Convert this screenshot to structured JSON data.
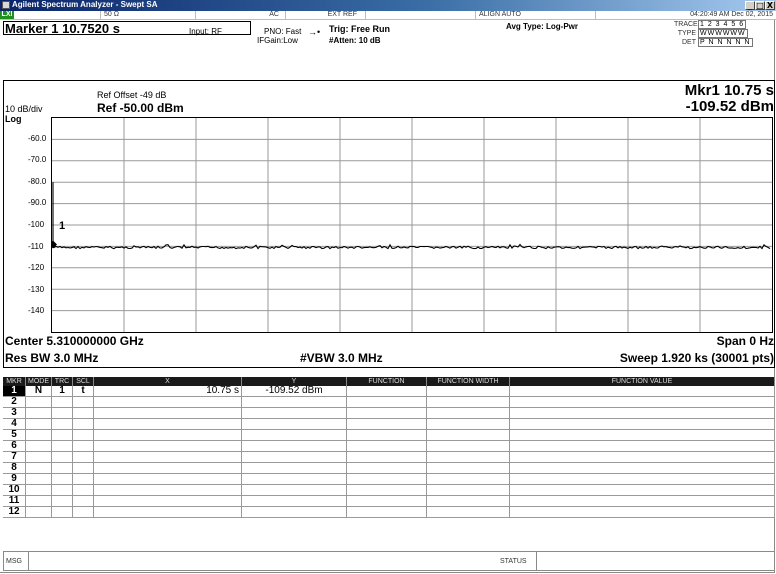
{
  "window": {
    "title": "Agilent Spectrum Analyzer - Swept SA",
    "minimize": "_",
    "maximize": "□",
    "close": "X"
  },
  "status_strip": {
    "lxi": "LXI",
    "impedance": "50 Ω",
    "coupling": "AC",
    "ref": "EXT REF",
    "align": "ALIGN AUTO",
    "datetime": "04:20:49 AM Dec 02, 2015"
  },
  "marker": {
    "title": "Marker 1  10.7520 s",
    "input": "Input: RF",
    "pno": "PNO: Fast",
    "ifgain": "IFGain:Low",
    "trig": "Trig: Free Run",
    "atten": "#Atten: 10 dB",
    "avg_type": "Avg Type: Log-Pwr"
  },
  "trace_info": {
    "trace_label": "TRACE",
    "trace_value": "1 2 3 4 5 6",
    "type_label": "TYPE",
    "type_value": "WWWWWW",
    "det_label": "DET",
    "det_value": "P N N N N N"
  },
  "plot": {
    "ref_offset": "Ref Offset -49 dB",
    "scale": "10 dB/div",
    "ref_level": "Ref -50.00 dBm",
    "log": "Log",
    "mkr_readout_x": "Mkr1 10.75 s",
    "mkr_readout_y": "-109.52 dBm",
    "y_ticks": [
      "-60.0",
      "-70.0",
      "-80.0",
      "-90.0",
      "-100",
      "-110",
      "-120",
      "-130",
      "-140"
    ],
    "marker_label": "1",
    "center": "Center 5.310000000 GHz",
    "span": "Span 0 Hz",
    "res_bw": "Res BW 3.0 MHz",
    "vbw": "#VBW 3.0 MHz",
    "sweep": "Sweep  1.920 ks (30001 pts)",
    "trace_level_dbm": -110.5,
    "ref_dbm": -50,
    "db_per_div": 10,
    "trace_color": "#000000"
  },
  "marker_table": {
    "headers": [
      "MKR",
      "MODE",
      "TRC",
      "SCL",
      "X",
      "Y",
      "FUNCTION",
      "FUNCTION WIDTH",
      "FUNCTION VALUE"
    ],
    "rows": [
      {
        "n": "1",
        "mode": "N",
        "trc": "1",
        "scl": "t",
        "x": "10.75 s",
        "y": "-109.52 dBm"
      },
      {
        "n": "2"
      },
      {
        "n": "3"
      },
      {
        "n": "4"
      },
      {
        "n": "5"
      },
      {
        "n": "6"
      },
      {
        "n": "7"
      },
      {
        "n": "8"
      },
      {
        "n": "9"
      },
      {
        "n": "10"
      },
      {
        "n": "11"
      },
      {
        "n": "12"
      }
    ]
  },
  "msg_bar": {
    "msg": "MSG",
    "status": "STATUS"
  }
}
